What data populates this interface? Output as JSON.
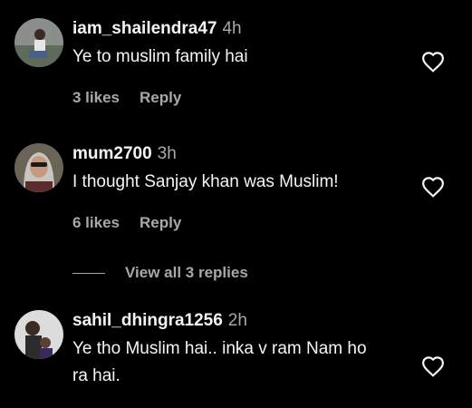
{
  "comments": [
    {
      "username": "iam_shailendra47",
      "time": "4h",
      "text": "Ye to muslim family hai",
      "likes": "3 likes",
      "reply": "Reply"
    },
    {
      "username": "mum2700",
      "time": "3h",
      "text": "I thought Sanjay khan was Muslim!",
      "likes": "6 likes",
      "reply": "Reply"
    },
    {
      "username": "sahil_dhingra1256",
      "time": "2h",
      "text": "Ye tho Muslim hai.. inka v ram Nam ho ra hai."
    }
  ],
  "view_replies": "View all 3 replies",
  "colors": {
    "background": "#000000",
    "text": "#f5f5f5",
    "secondary": "#a8a8a8"
  },
  "icons": [
    "avatar",
    "heart-icon"
  ]
}
